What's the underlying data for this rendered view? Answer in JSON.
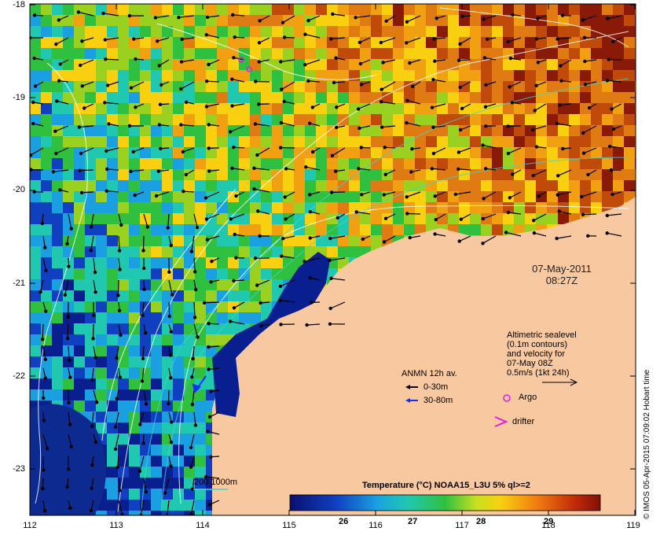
{
  "map": {
    "lon_ticks": [
      "112",
      "113",
      "114",
      "115",
      "116",
      "117",
      "118",
      "119"
    ],
    "lat_ticks": [
      "-18",
      "-19",
      "-20",
      "-21",
      "-22",
      "-23"
    ],
    "date_stamp": {
      "date": "07-May-2011",
      "time": "08:27Z"
    },
    "altimetry_note": [
      "Altimetric sealevel",
      "(0.1m contours)",
      "and velocity for",
      "07-May 08Z",
      "0.5m/s (1kt 24h)"
    ],
    "anmn": {
      "title": "ANMN 12h av.",
      "shallow": "0-30m",
      "deep": "30-80m"
    },
    "argo_label": "Argo",
    "drifter_label": "drifter",
    "depth_legend": "200  1000m",
    "colorbar": {
      "title": "Temperature (°C) NOAA15_L3U 5% ql>=2",
      "ticks": [
        "26",
        "27",
        "28",
        "29"
      ]
    },
    "credit": "© IMOS 05-Apr-2015 07:09:02 Hobart time",
    "colors": {
      "land": "#f8c9a0",
      "cold": "#0a1f8f",
      "warm": "#e07a12",
      "hot": "#8a1a08",
      "contour": "#ffffff",
      "bathy": "#3dd6d0",
      "argo": "#e020e0"
    }
  }
}
